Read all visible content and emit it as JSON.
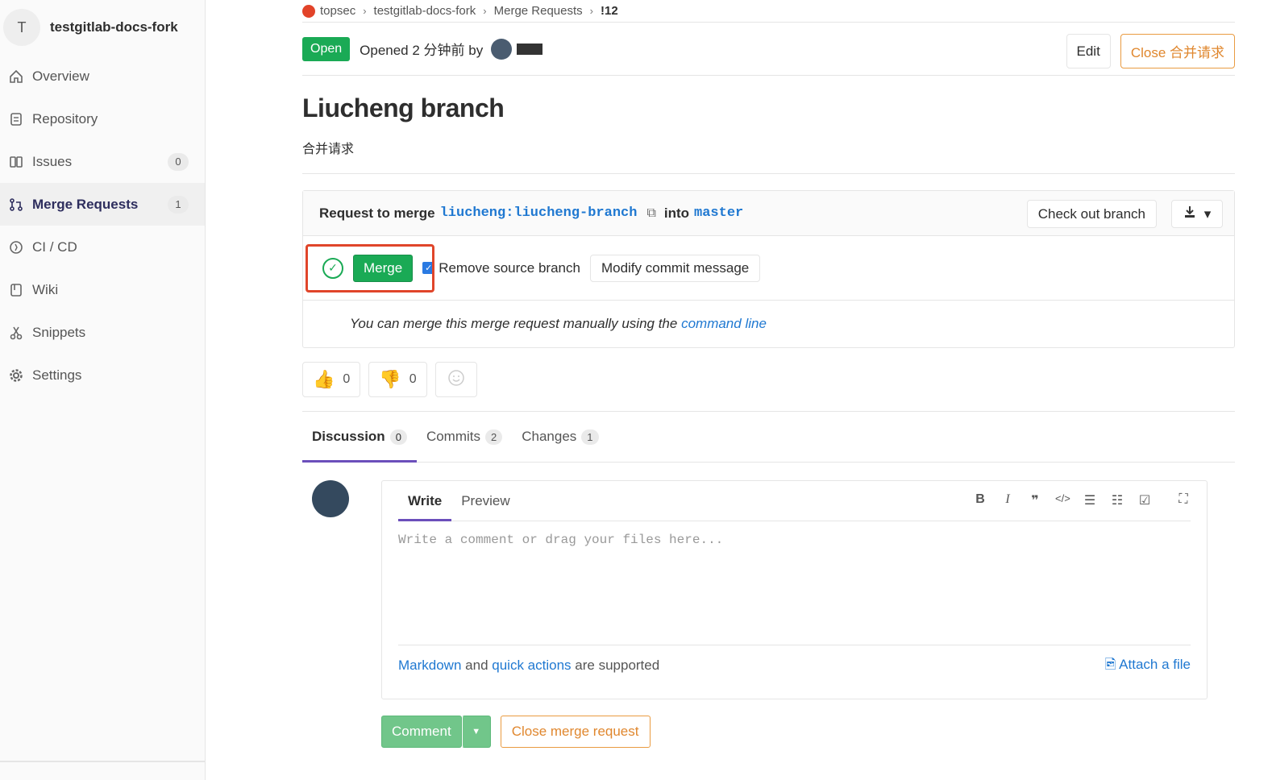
{
  "sidebar": {
    "project_initial": "T",
    "project_name": "testgitlab-docs-fork",
    "items": [
      {
        "label": "Overview",
        "icon": "home-icon"
      },
      {
        "label": "Repository",
        "icon": "document-icon"
      },
      {
        "label": "Issues",
        "icon": "issues-icon",
        "badge": "0"
      },
      {
        "label": "Merge Requests",
        "icon": "merge-request-icon",
        "badge": "1"
      },
      {
        "label": "CI / CD",
        "icon": "rocket-icon"
      },
      {
        "label": "Wiki",
        "icon": "book-icon"
      },
      {
        "label": "Snippets",
        "icon": "scissors-icon"
      },
      {
        "label": "Settings",
        "icon": "gear-icon"
      }
    ]
  },
  "breadcrumb": {
    "group": "topsec",
    "project": "testgitlab-docs-fork",
    "section": "Merge Requests",
    "current": "!12"
  },
  "header": {
    "status": "Open",
    "opened_text": "Opened 2 分钟前 by",
    "edit_label": "Edit",
    "close_label": "Close 合并请求"
  },
  "mr": {
    "title": "Liucheng branch",
    "description": "合并请求"
  },
  "widget": {
    "request_label": "Request to merge",
    "source_branch": "liucheng:liucheng-branch",
    "into_label": "into",
    "target_branch": "master",
    "checkout_label": "Check out branch",
    "merge_label": "Merge",
    "remove_source_label": "Remove source branch",
    "modify_commit_label": "Modify commit message",
    "manual_text": "You can merge this merge request manually using the",
    "command_line_link": "command line"
  },
  "awards": {
    "thumbsup": "0",
    "thumbsdown": "0"
  },
  "tabs": [
    {
      "label": "Discussion",
      "count": "0"
    },
    {
      "label": "Commits",
      "count": "2"
    },
    {
      "label": "Changes",
      "count": "1"
    }
  ],
  "editor": {
    "write_tab": "Write",
    "preview_tab": "Preview",
    "placeholder": "Write a comment or drag your files here...",
    "markdown_link": "Markdown",
    "and_text": "and",
    "quick_actions_link": "quick actions",
    "supported_text": "are supported",
    "attach_label": "Attach a file"
  },
  "actions": {
    "comment_label": "Comment",
    "close_mr_label": "Close merge request"
  },
  "colors": {
    "accent": "#1aaa55",
    "link": "#1f78d1",
    "warning": "#e0872e",
    "tab_underline": "#6b4fbb",
    "highlight": "#e0452a"
  }
}
